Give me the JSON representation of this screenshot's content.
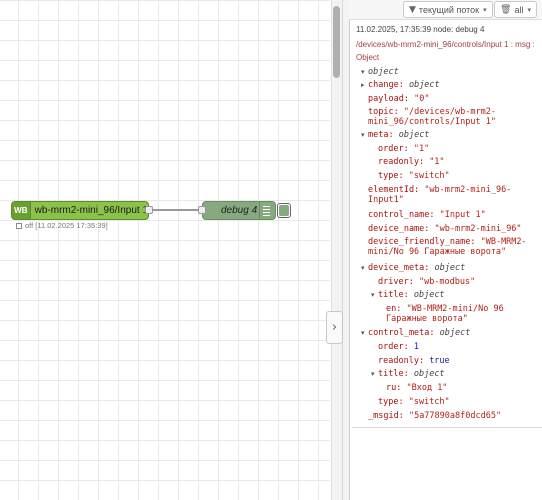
{
  "workspace": {
    "collapse_glyph": "›",
    "wb_node": {
      "icon_text": "WB",
      "label": "wb-mrm2-mini_96/Input 1",
      "status": "off [11.02.2025 17:35:39]"
    },
    "debug_node": {
      "label": "debug 4"
    }
  },
  "sidebar": {
    "toolbar": {
      "filter_label": "текущий поток",
      "filter_icon": "filter-icon",
      "clear_label": "all",
      "clear_icon": "trash-icon"
    },
    "message": {
      "meta": "11.02.2025, 17:35:39   node: debug 4",
      "path": "/devices/wb-mrm2-mini_96/controls/Input 1 : msg : Object",
      "root_type": "object",
      "rows": {
        "change_key": "change:",
        "change_type": "object",
        "payload_key": "payload:",
        "payload_val": "\"0\"",
        "topic_key": "topic:",
        "topic_val1": "\"/devices/wb-mrm2-",
        "topic_val2": "mini_96/controls/Input 1\"",
        "meta_key": "meta:",
        "meta_type": "object",
        "order_key": "order:",
        "order_val": "\"1\"",
        "readonly_key": "readonly:",
        "readonly_val": "\"1\"",
        "type_key": "type:",
        "type_val": "\"switch\"",
        "element_key": "elementId:",
        "element_val1": "\"wb-mrm2-mini_96-",
        "element_val2": "Input1\"",
        "control_name_key": "control_name:",
        "control_name_val": "\"Input 1\"",
        "device_name_key": "device_name:",
        "device_name_val": "\"wb-mrm2-mini_96\"",
        "dfn_key": "device_friendly_name:",
        "dfn_val1": "\"WB-MRM2-",
        "dfn_val2": "mini/No 96 Гаражные ворота\"",
        "device_meta_key": "device_meta:",
        "device_meta_type": "object",
        "driver_key": "driver:",
        "driver_val": "\"wb-modbus\"",
        "dm_title_key": "title:",
        "dm_title_type": "object",
        "en_key": "en:",
        "en_val1": "\"WB-MRM2-mini/No 96",
        "en_val2": "Гаражные ворота\"",
        "control_meta_key": "control_meta:",
        "control_meta_type": "object",
        "cm_order_key": "order:",
        "cm_order_val": "1",
        "cm_readonly_key": "readonly:",
        "cm_readonly_val": "true",
        "cm_title_key": "title:",
        "cm_title_type": "object",
        "ru_key": "ru:",
        "ru_val": "\"Вход 1\"",
        "cm_type_key": "type:",
        "cm_type_val": "\"switch\"",
        "msgid_key": "_msgid:",
        "msgid_val": "\"5a77890a8f0dcd65\""
      }
    }
  },
  "colors": {
    "wb_node": "#8bc34a",
    "debug_node": "#87a980",
    "json_key": "#aa1111",
    "json_string": "#b2221c",
    "json_number": "#1a1aa6"
  }
}
